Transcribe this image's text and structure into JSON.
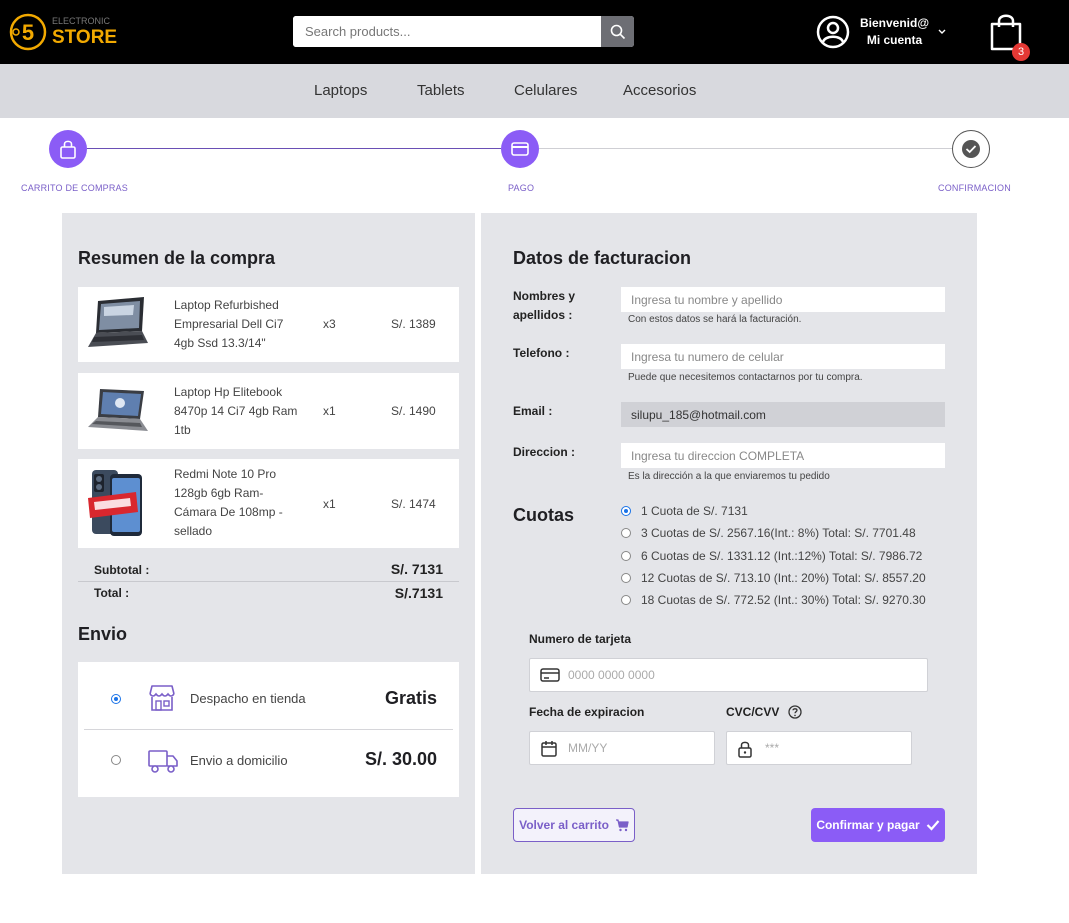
{
  "header": {
    "logo_text": "STORE",
    "logo_small": "ELECTRONIC",
    "logo_numeral": "5",
    "search_placeholder": "Search products...",
    "account_greeting": "Bienvenid@",
    "account_link": "Mi cuenta",
    "cart_count": "3"
  },
  "categories": [
    "Laptops",
    "Tablets",
    "Celulares",
    "Accesorios"
  ],
  "stepper": {
    "steps": [
      {
        "label": "CARRITO DE COMPRAS",
        "icon": "shopping-bag-icon"
      },
      {
        "label": "PAGO",
        "icon": "credit-card-icon"
      },
      {
        "label": "CONFIRMACION",
        "icon": "check-circle-icon"
      }
    ]
  },
  "summary": {
    "title": "Resumen de la compra",
    "items": [
      {
        "name": "Laptop Refurbished Empresarial Dell Ci7 4gb Ssd 13.3/14\"",
        "qty": "x3",
        "price": "S/. 1389"
      },
      {
        "name": "Laptop Hp Elitebook 8470p 14 Ci7 4gb Ram 1tb",
        "qty": "x1",
        "price": "S/. 1490"
      },
      {
        "name": "Redmi Note 10 Pro 128gb 6gb Ram- Cámara De 108mp - sellado",
        "qty": "x1",
        "price": "S/. 1474"
      }
    ],
    "subtotal_label": "Subtotal :",
    "subtotal_value": "S/. 7131",
    "total_label": "Total :",
    "total_value": "S/.7131"
  },
  "envio": {
    "title": "Envio",
    "options": [
      {
        "label": "Despacho en tienda",
        "price": "Gratis",
        "selected": true
      },
      {
        "label": "Envio a domicilio",
        "price": "S/. 30.00",
        "selected": false
      }
    ]
  },
  "billing": {
    "title": "Datos de facturacion",
    "name_label_1": "Nombres y",
    "name_label_2": "apellidos :",
    "name_placeholder": "Ingresa tu nombre y apellido",
    "name_help": "Con estos datos se hará la facturación.",
    "phone_label": "Telefono :",
    "phone_placeholder": "Ingresa tu numero de celular",
    "phone_help": "Puede que necesitemos contactarnos por tu compra.",
    "email_label": "Email :",
    "email_value": "silupu_185@hotmail.com",
    "address_label": "Direccion :",
    "address_placeholder": "Ingresa tu direccion COMPLETA",
    "address_help": "Es la dirección a la que enviaremos tu pedido"
  },
  "cuotas": {
    "title": "Cuotas",
    "options": [
      {
        "label": "1 Cuota de S/. 7131",
        "selected": true
      },
      {
        "label": "3 Cuotas de S/. 2567.16(Int.: 8%) Total: S/. 7701.48",
        "selected": false
      },
      {
        "label": "6 Cuotas de S/. 1331.12 (Int.:12%) Total: S/. 7986.72",
        "selected": false
      },
      {
        "label": "12 Cuotas de S/. 713.10 (Int.: 20%) Total: S/. 8557.20",
        "selected": false
      },
      {
        "label": "18 Cuotas de S/. 772.52 (Int.: 30%) Total: S/. 9270.30",
        "selected": false
      }
    ]
  },
  "card": {
    "number_label": "Numero de tarjeta",
    "number_placeholder": "0000 0000 0000",
    "expiry_label": "Fecha de expiracion",
    "expiry_placeholder": "MM/YY",
    "cvc_label": "CVC/CVV",
    "cvc_placeholder": "***"
  },
  "actions": {
    "back_label": "Volver al carrito",
    "confirm_label": "Confirmar y pagar"
  },
  "colors": {
    "accent": "#8b5cf6",
    "header_bg": "#000000",
    "nav_bg": "#d8d9de",
    "panel_bg": "#e4e5e9",
    "badge": "#e53935",
    "logo_gold": "#f2a900"
  }
}
